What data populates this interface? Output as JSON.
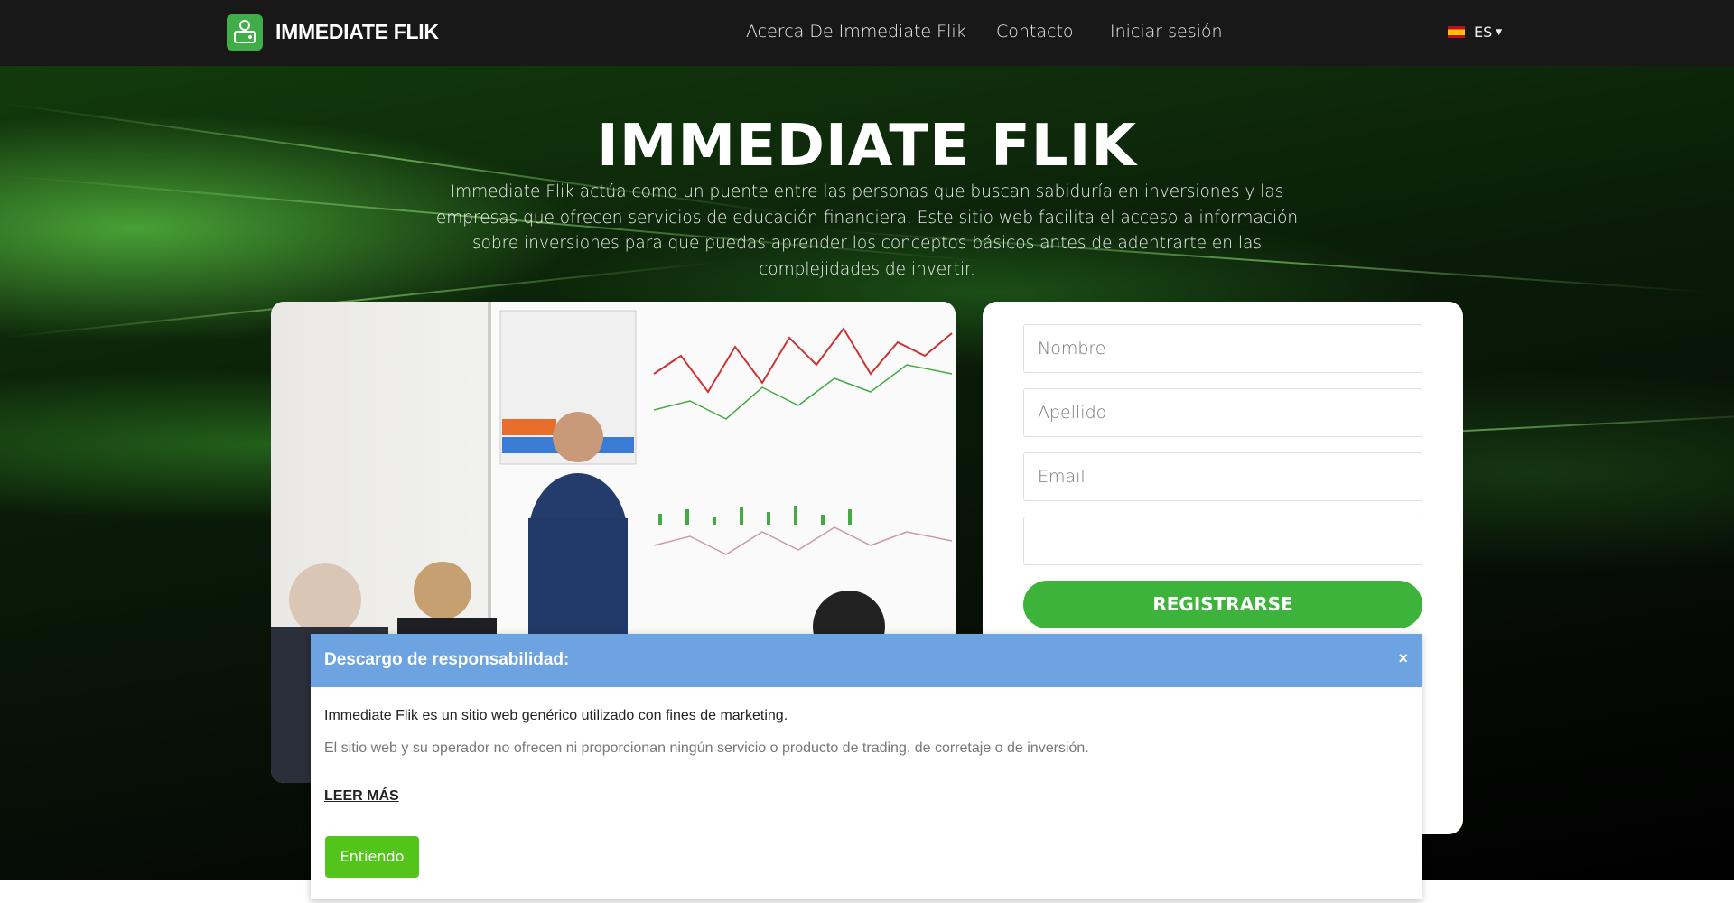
{
  "header": {
    "brand": "IMMEDIATE FLIK",
    "nav": [
      "Acerca De Immediate Flik",
      "Contacto",
      "Iniciar sesión"
    ],
    "language": "ES"
  },
  "hero": {
    "title": "IMMEDIATE FLIK",
    "description": "Immediate Flik actúa como un puente entre las personas que buscan sabiduría en inversiones y las empresas que ofrecen servicios de educación financiera. Este sitio web facilita el acceso a información sobre inversiones para que puedas aprender los conceptos básicos antes de adentrarte en las complejidades de invertir."
  },
  "form": {
    "first_name_placeholder": "Nombre",
    "last_name_placeholder": "Apellido",
    "email_placeholder": "Email",
    "phone_placeholder": "",
    "submit": "REGISTRARSE"
  },
  "disclaimer": {
    "title": "Descargo de responsabilidad:",
    "close": "×",
    "line1": "Immediate Flik es un sitio web genérico utilizado con fines de marketing.",
    "line2": "El sitio web y su operador no ofrecen ni proporcionan ningún servicio o producto de trading, de corretaje o de inversión.",
    "read_more": "LEER MÁS",
    "accept": "Entiendo"
  },
  "colors": {
    "accent": "#3db33b",
    "modal_header": "#6ca3e0",
    "header_bg": "#181818"
  }
}
